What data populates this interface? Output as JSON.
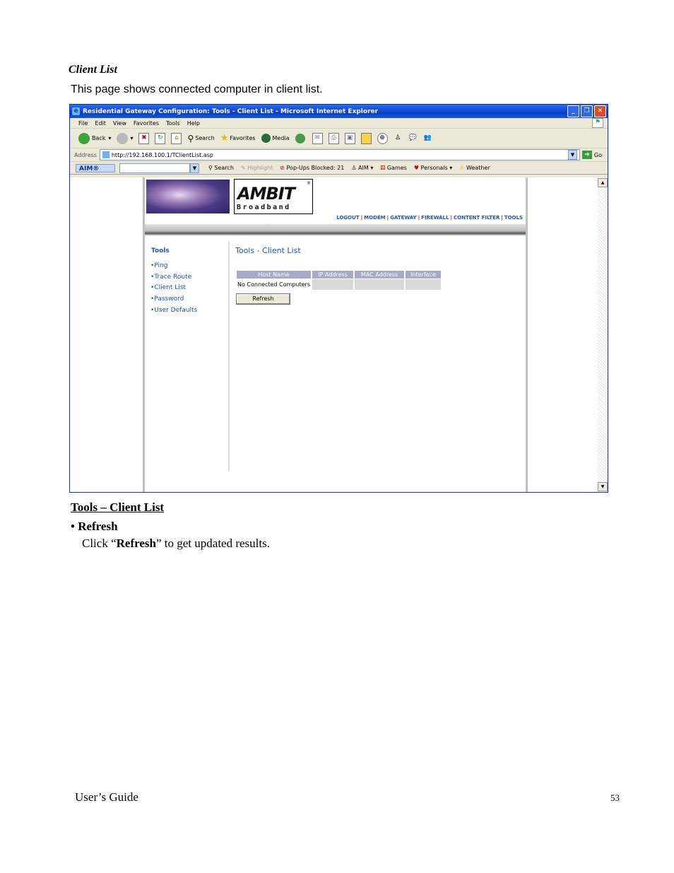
{
  "doc": {
    "title": "Client List",
    "intro": "This page shows connected computer in client list.",
    "section_head": "Tools – Client List",
    "bullet": "• Refresh",
    "bullet_desc_pre": "Click “",
    "bullet_desc_bold": "Refresh",
    "bullet_desc_post": "” to get updated results.",
    "footer_left": "User’s Guide",
    "page_number": "53"
  },
  "browser": {
    "title": "Residential Gateway Configuration: Tools - Client List - Microsoft Internet Explorer",
    "menu": [
      "File",
      "Edit",
      "View",
      "Favorites",
      "Tools",
      "Help"
    ],
    "toolbar": {
      "back": "Back",
      "search": "Search",
      "favorites": "Favorites",
      "media": "Media"
    },
    "address_label": "Address",
    "url": "http://192.168.100.1/TClientList.asp",
    "go": "Go",
    "aim_logo": "AIM®",
    "aim": {
      "search": "Search",
      "highlight": "Highlight",
      "popups": "Pop-Ups Blocked: 21",
      "aim": "AIM",
      "games": "Games",
      "personals": "Personals",
      "weather": "Weather"
    }
  },
  "page": {
    "brand_top": "AMBIT",
    "brand_bottom": "Broadband",
    "topnav": [
      "LOGOUT",
      "MODEM",
      "GATEWAY",
      "FIREWALL",
      "CONTENT FILTER",
      "TOOLS"
    ],
    "nav_heading": "Tools",
    "nav_items": [
      "•Ping",
      "•Trace Route",
      "•Client List",
      "•Password",
      "•User Defaults"
    ],
    "title": "Tools - Client List",
    "table_headers": [
      "Host Name",
      "IP Address",
      "MAC Address",
      "Interface"
    ],
    "table_rows": [
      [
        "No Connected Computers",
        "",
        "",
        ""
      ]
    ],
    "refresh_label": "Refresh"
  }
}
